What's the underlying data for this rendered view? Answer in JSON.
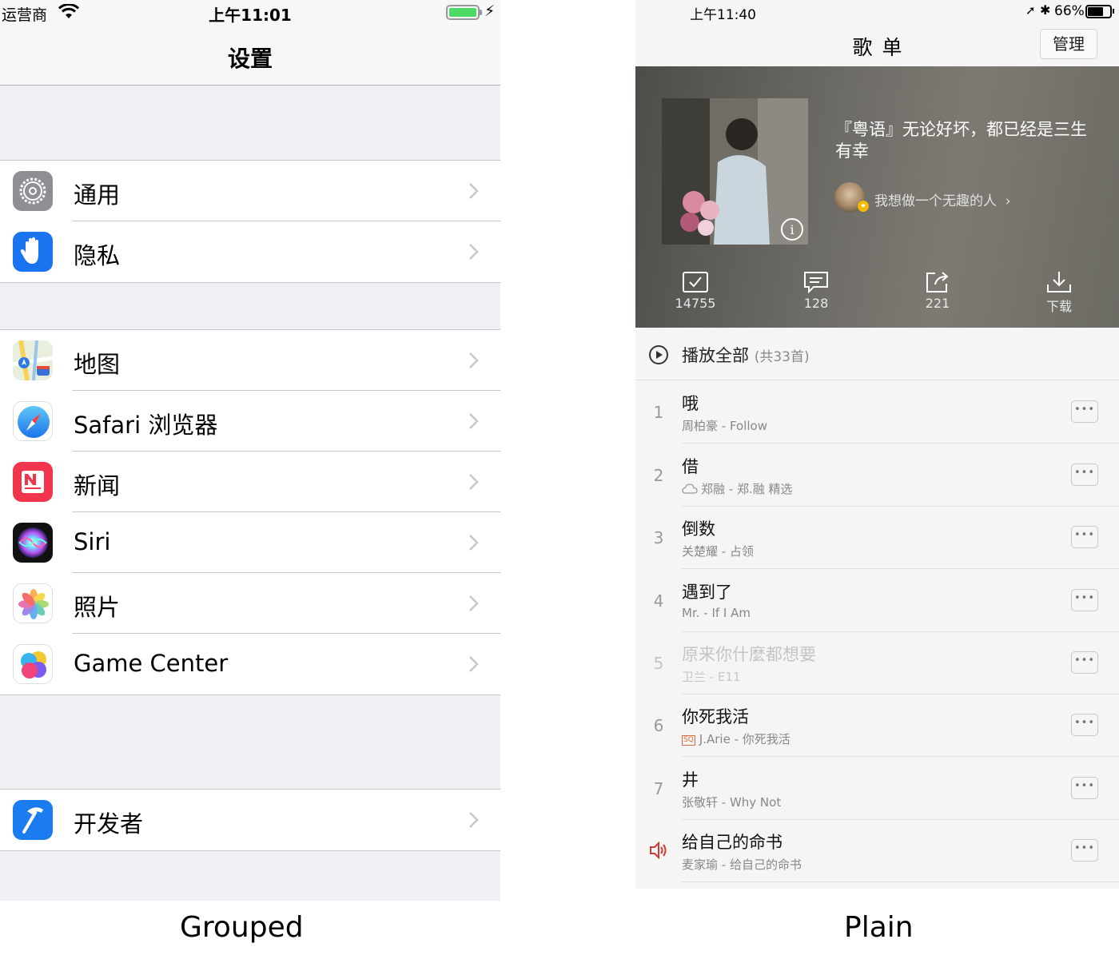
{
  "grouped": {
    "caption": "Grouped",
    "status": {
      "carrier": "运营商",
      "time": "上午11:01"
    },
    "nav_title": "设置",
    "groups": [
      {
        "items": [
          {
            "label": "通用",
            "icon": "gear-icon"
          },
          {
            "label": "隐私",
            "icon": "hand-icon"
          }
        ]
      },
      {
        "items": [
          {
            "label": "地图",
            "icon": "maps-icon"
          },
          {
            "label": "Safari 浏览器",
            "icon": "compass-icon"
          },
          {
            "label": "新闻",
            "icon": "news-icon"
          },
          {
            "label": "Siri",
            "icon": "siri-icon"
          },
          {
            "label": "照片",
            "icon": "photos-icon"
          },
          {
            "label": "Game Center",
            "icon": "game-center-icon"
          }
        ]
      },
      {
        "items": [
          {
            "label": "开发者",
            "icon": "hammer-icon"
          }
        ]
      }
    ]
  },
  "plain": {
    "caption": "Plain",
    "status": {
      "time": "上午11:40",
      "battery": "66%",
      "battery_level": 0.66
    },
    "nav_title": "歌单",
    "manage_label": "管理",
    "playlist": {
      "name": "『粤语』无论好坏，都已经是三生有幸",
      "creator": "我想做一个无趣的人",
      "actions": [
        {
          "label": "14755",
          "icon": "collect-icon"
        },
        {
          "label": "128",
          "icon": "comment-icon"
        },
        {
          "label": "221",
          "icon": "share-icon"
        },
        {
          "label": "下载",
          "icon": "download-icon"
        }
      ]
    },
    "play_all": {
      "label": "播放全部",
      "count": "(共33首)"
    },
    "tracks": [
      {
        "num": "1",
        "title": "哦",
        "artist": "周柏豪 - Follow",
        "badge": ""
      },
      {
        "num": "2",
        "title": "借",
        "artist": "郑融 - 郑.融 精选",
        "badge": "cloud"
      },
      {
        "num": "3",
        "title": "倒数",
        "artist": "关楚耀 - 占领",
        "badge": ""
      },
      {
        "num": "4",
        "title": "遇到了",
        "artist": "Mr. - If I Am",
        "badge": ""
      },
      {
        "num": "5",
        "title": "原来你什麼都想要",
        "artist": "卫兰 - E11",
        "badge": "",
        "dim": true
      },
      {
        "num": "6",
        "title": "你死我活",
        "artist": "J.Arie - 你死我活",
        "badge": "SQ"
      },
      {
        "num": "7",
        "title": "井",
        "artist": "张敬轩 - Why Not",
        "badge": ""
      },
      {
        "num": "",
        "title": "给自己的命书",
        "artist": "麦家瑜 - 给自己的命书",
        "badge": "",
        "playing": true
      }
    ],
    "colors": {
      "accent_playing": "#d33a31"
    }
  }
}
